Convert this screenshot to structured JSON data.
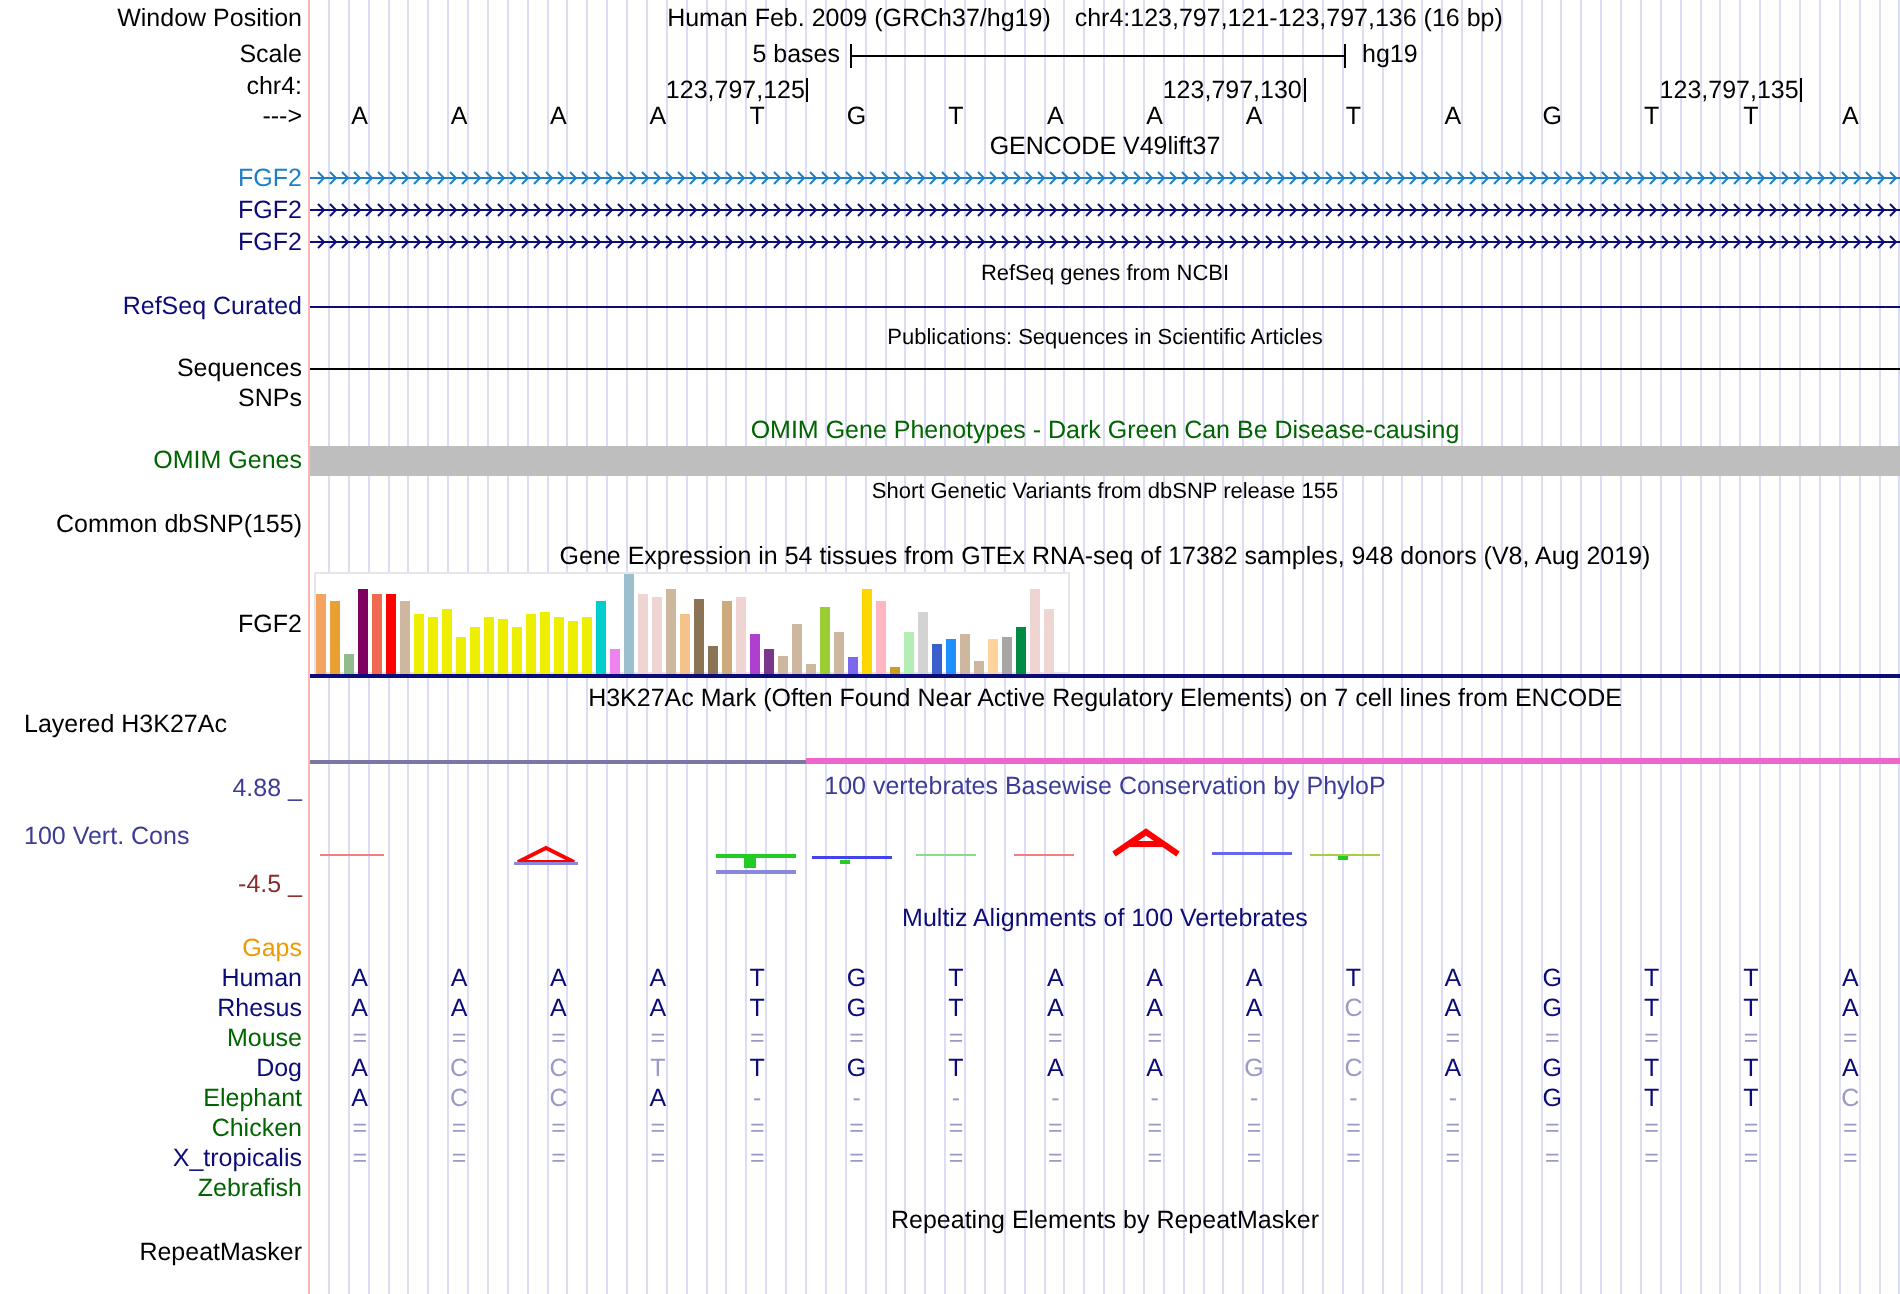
{
  "header": {
    "position_label": "Window Position",
    "assembly": "Human Feb. 2009 (GRCh37/hg19)",
    "position": "chr4:123,797,121-123,797,136 (16 bp)",
    "scale_label": "Scale",
    "scale_text": "5 bases",
    "scale_db": "hg19",
    "chrom_label": "chr4:",
    "ticks": [
      "123,797,125",
      "123,797,130",
      "123,797,135"
    ],
    "strand_label": "--->",
    "bases": [
      "A",
      "A",
      "A",
      "A",
      "T",
      "G",
      "T",
      "A",
      "A",
      "A",
      "T",
      "A",
      "G",
      "T",
      "T",
      "A"
    ]
  },
  "tracks": [
    {
      "kind": "gene",
      "title": "GENCODE V49lift37",
      "rows": [
        {
          "label": "FGF2",
          "color": "#1e7fc4"
        },
        {
          "label": "FGF2",
          "color": "#0c0c78"
        },
        {
          "label": "FGF2",
          "color": "#0c0c78"
        }
      ]
    },
    {
      "kind": "line",
      "title": "RefSeq genes from NCBI",
      "small_title": true,
      "rows": [
        {
          "label": "RefSeq Curated",
          "color": "#0c0c78",
          "line": true
        }
      ]
    },
    {
      "kind": "line",
      "title": "Publications: Sequences in Scientific Articles",
      "small_title": true,
      "rows": [
        {
          "label": "Sequences",
          "color": "#000000",
          "line": true
        },
        {
          "label": "SNPs",
          "color": "#000000",
          "line": false
        }
      ]
    },
    {
      "kind": "block",
      "title": "OMIM Gene Phenotypes - Dark Green Can Be Disease-causing",
      "color": "#006400",
      "rows": [
        {
          "label": "OMIM Genes",
          "color": "#006400"
        }
      ]
    },
    {
      "kind": "empty",
      "title": "Short Genetic Variants from dbSNP release 155",
      "small_title": true,
      "rows": [
        {
          "label": "Common dbSNP(155)",
          "color": "#000000"
        }
      ]
    },
    {
      "kind": "expression",
      "title": "Gene Expression in 54 tissues from GTEx RNA-seq of 17382 samples, 948 donors (V8, Aug 2019)",
      "rows": [
        {
          "label": "FGF2",
          "color": "#000000"
        }
      ]
    },
    {
      "kind": "layered",
      "title": "H3K27Ac Mark (Often Found Near Active Regulatory Elements) on 7 cell lines from ENCODE",
      "rows": [
        {
          "label": "Layered H3K27Ac",
          "color": "#000000"
        }
      ]
    },
    {
      "kind": "phylop",
      "title": "100 vertebrates Basewise Conservation by PhyloP",
      "color": "#3c3c96",
      "label": "100 Vert. Cons",
      "max": "4.88 _",
      "min": "-4.5 _"
    },
    {
      "kind": "multiz",
      "title": "Multiz Alignments of 100 Vertebrates",
      "color": "#0c0c78",
      "species": [
        {
          "label": "Gaps",
          "color": "#ee9a00"
        },
        {
          "label": "Human",
          "color": "#0c0c78",
          "bases": [
            {
              "b": "A",
              "dim": false
            },
            {
              "b": "A",
              "dim": false
            },
            {
              "b": "A",
              "dim": false
            },
            {
              "b": "A",
              "dim": false
            },
            {
              "b": "T",
              "dim": false
            },
            {
              "b": "G",
              "dim": false
            },
            {
              "b": "T",
              "dim": false
            },
            {
              "b": "A",
              "dim": false
            },
            {
              "b": "A",
              "dim": false
            },
            {
              "b": "A",
              "dim": false
            },
            {
              "b": "T",
              "dim": false
            },
            {
              "b": "A",
              "dim": false
            },
            {
              "b": "G",
              "dim": false
            },
            {
              "b": "T",
              "dim": false
            },
            {
              "b": "T",
              "dim": false
            },
            {
              "b": "A",
              "dim": false
            }
          ]
        },
        {
          "label": "Rhesus",
          "color": "#0c0c78",
          "bases": [
            {
              "b": "A",
              "dim": false
            },
            {
              "b": "A",
              "dim": false
            },
            {
              "b": "A",
              "dim": false
            },
            {
              "b": "A",
              "dim": false
            },
            {
              "b": "T",
              "dim": false
            },
            {
              "b": "G",
              "dim": false
            },
            {
              "b": "T",
              "dim": false
            },
            {
              "b": "A",
              "dim": false
            },
            {
              "b": "A",
              "dim": false
            },
            {
              "b": "A",
              "dim": false
            },
            {
              "b": "C",
              "dim": true
            },
            {
              "b": "A",
              "dim": false
            },
            {
              "b": "G",
              "dim": false
            },
            {
              "b": "T",
              "dim": false
            },
            {
              "b": "T",
              "dim": false
            },
            {
              "b": "A",
              "dim": false
            }
          ]
        },
        {
          "label": "Mouse",
          "color": "#006400",
          "bases": [
            {
              "b": "=",
              "dim": true
            },
            {
              "b": "=",
              "dim": true
            },
            {
              "b": "=",
              "dim": true
            },
            {
              "b": "=",
              "dim": true
            },
            {
              "b": "=",
              "dim": true
            },
            {
              "b": "=",
              "dim": true
            },
            {
              "b": "=",
              "dim": true
            },
            {
              "b": "=",
              "dim": true
            },
            {
              "b": "=",
              "dim": true
            },
            {
              "b": "=",
              "dim": true
            },
            {
              "b": "=",
              "dim": true
            },
            {
              "b": "=",
              "dim": true
            },
            {
              "b": "=",
              "dim": true
            },
            {
              "b": "=",
              "dim": true
            },
            {
              "b": "=",
              "dim": true
            },
            {
              "b": "=",
              "dim": true
            }
          ]
        },
        {
          "label": "Dog",
          "color": "#0c0c78",
          "bases": [
            {
              "b": "A",
              "dim": false
            },
            {
              "b": "C",
              "dim": true
            },
            {
              "b": "C",
              "dim": true
            },
            {
              "b": "T",
              "dim": true
            },
            {
              "b": "T",
              "dim": false
            },
            {
              "b": "G",
              "dim": false
            },
            {
              "b": "T",
              "dim": false
            },
            {
              "b": "A",
              "dim": false
            },
            {
              "b": "A",
              "dim": false
            },
            {
              "b": "G",
              "dim": true
            },
            {
              "b": "C",
              "dim": true
            },
            {
              "b": "A",
              "dim": false
            },
            {
              "b": "G",
              "dim": false
            },
            {
              "b": "T",
              "dim": false
            },
            {
              "b": "T",
              "dim": false
            },
            {
              "b": "A",
              "dim": false
            }
          ]
        },
        {
          "label": "Elephant",
          "color": "#006400",
          "bases": [
            {
              "b": "A",
              "dim": false
            },
            {
              "b": "C",
              "dim": true
            },
            {
              "b": "C",
              "dim": true
            },
            {
              "b": "A",
              "dim": false
            },
            {
              "b": "-",
              "dim": true
            },
            {
              "b": "-",
              "dim": true
            },
            {
              "b": "-",
              "dim": true
            },
            {
              "b": "-",
              "dim": true
            },
            {
              "b": "-",
              "dim": true
            },
            {
              "b": "-",
              "dim": true
            },
            {
              "b": "-",
              "dim": true
            },
            {
              "b": "-",
              "dim": true
            },
            {
              "b": "G",
              "dim": false
            },
            {
              "b": "T",
              "dim": false
            },
            {
              "b": "T",
              "dim": false
            },
            {
              "b": "C",
              "dim": true
            }
          ]
        },
        {
          "label": "Chicken",
          "color": "#006400",
          "bases": [
            {
              "b": "=",
              "dim": true
            },
            {
              "b": "=",
              "dim": true
            },
            {
              "b": "=",
              "dim": true
            },
            {
              "b": "=",
              "dim": true
            },
            {
              "b": "=",
              "dim": true
            },
            {
              "b": "=",
              "dim": true
            },
            {
              "b": "=",
              "dim": true
            },
            {
              "b": "=",
              "dim": true
            },
            {
              "b": "=",
              "dim": true
            },
            {
              "b": "=",
              "dim": true
            },
            {
              "b": "=",
              "dim": true
            },
            {
              "b": "=",
              "dim": true
            },
            {
              "b": "=",
              "dim": true
            },
            {
              "b": "=",
              "dim": true
            },
            {
              "b": "=",
              "dim": true
            },
            {
              "b": "=",
              "dim": true
            }
          ]
        },
        {
          "label": "X_tropicalis",
          "color": "#0c0c78",
          "bases": [
            {
              "b": "=",
              "dim": true
            },
            {
              "b": "=",
              "dim": true
            },
            {
              "b": "=",
              "dim": true
            },
            {
              "b": "=",
              "dim": true
            },
            {
              "b": "=",
              "dim": true
            },
            {
              "b": "=",
              "dim": true
            },
            {
              "b": "=",
              "dim": true
            },
            {
              "b": "=",
              "dim": true
            },
            {
              "b": "=",
              "dim": true
            },
            {
              "b": "=",
              "dim": true
            },
            {
              "b": "=",
              "dim": true
            },
            {
              "b": "=",
              "dim": true
            },
            {
              "b": "=",
              "dim": true
            },
            {
              "b": "=",
              "dim": true
            },
            {
              "b": "=",
              "dim": true
            },
            {
              "b": "=",
              "dim": true
            }
          ]
        },
        {
          "label": "Zebrafish",
          "color": "#006400"
        }
      ]
    },
    {
      "kind": "empty",
      "title": "Repeating Elements by RepeatMasker",
      "rows": [
        {
          "label": "RepeatMasker",
          "color": "#000000"
        }
      ]
    }
  ]
}
